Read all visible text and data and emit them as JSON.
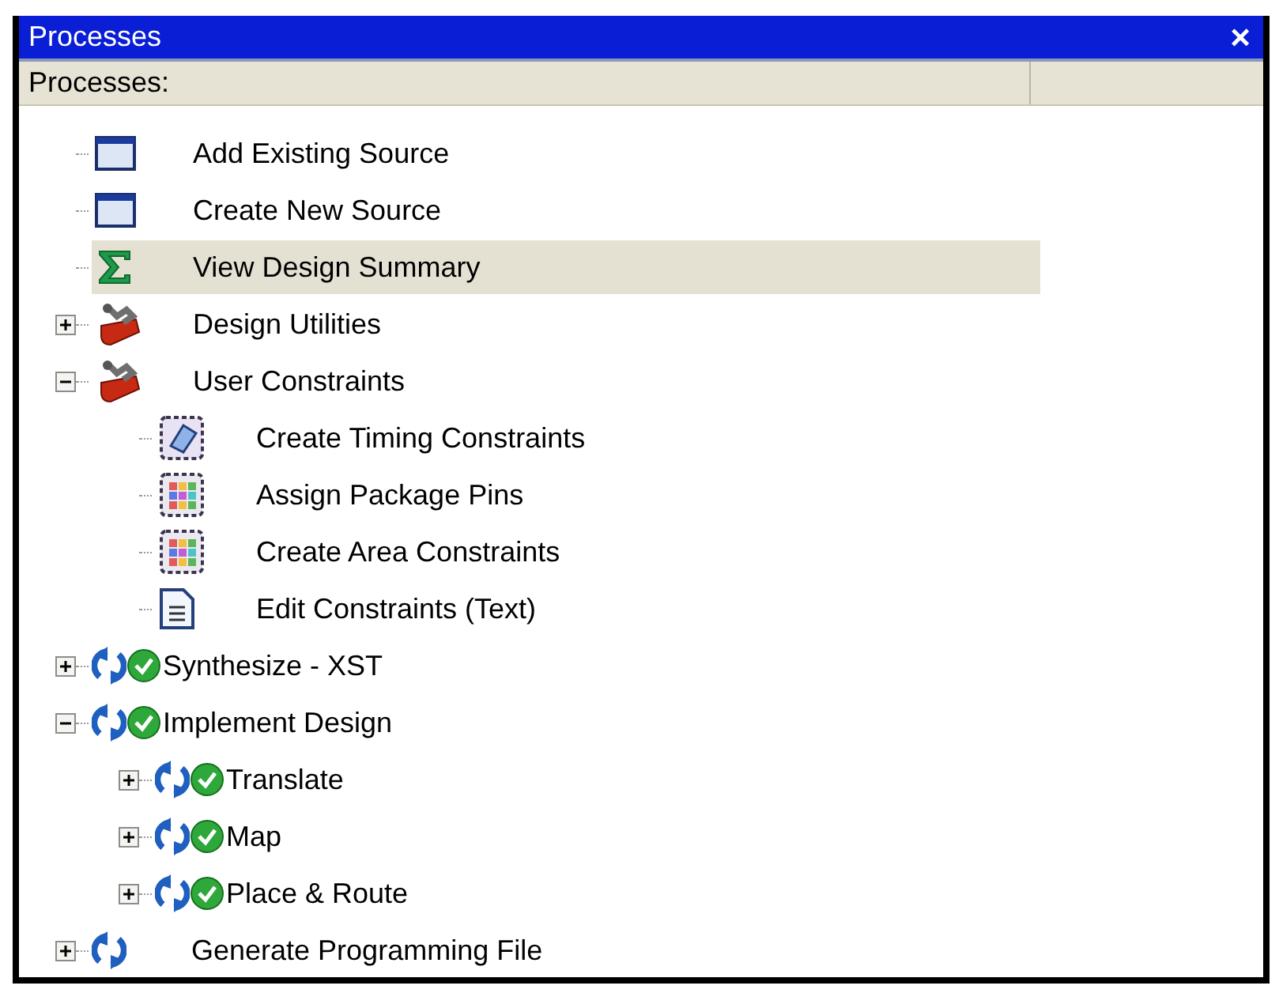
{
  "window": {
    "title": "Processes",
    "close": "×"
  },
  "header": {
    "column_1": "Processes:"
  },
  "tree": [
    {
      "kind": "source",
      "label": "Add Existing Source",
      "selected": false
    },
    {
      "kind": "source",
      "label": "Create New Source",
      "selected": false
    },
    {
      "kind": "summary",
      "label": "View Design Summary",
      "selected": true
    },
    {
      "kind": "toolbox",
      "label": "Design Utilities",
      "selected": false,
      "expanded": false
    },
    {
      "kind": "toolbox",
      "label": "User Constraints",
      "selected": false,
      "expanded": true,
      "children": [
        {
          "kind": "timing",
          "label": "Create Timing Constraints",
          "selected": false
        },
        {
          "kind": "pins",
          "label": "Assign Package Pins",
          "selected": false
        },
        {
          "kind": "pins",
          "label": "Create Area Constraints",
          "selected": false
        },
        {
          "kind": "text",
          "label": "Edit Constraints (Text)",
          "selected": false
        }
      ]
    },
    {
      "kind": "process",
      "label": "Synthesize - XST",
      "selected": false,
      "expanded": false,
      "done": true
    },
    {
      "kind": "process",
      "label": "Implement Design",
      "selected": false,
      "expanded": true,
      "done": true,
      "children": [
        {
          "kind": "process",
          "label": "Translate",
          "selected": false,
          "expanded": false,
          "done": true
        },
        {
          "kind": "process",
          "label": "Map",
          "selected": false,
          "expanded": false,
          "done": true
        },
        {
          "kind": "process",
          "label": "Place & Route",
          "selected": false,
          "expanded": false,
          "done": true
        }
      ]
    },
    {
      "kind": "process",
      "label": "Generate Programming File",
      "selected": false,
      "expanded": false,
      "done": false
    }
  ]
}
